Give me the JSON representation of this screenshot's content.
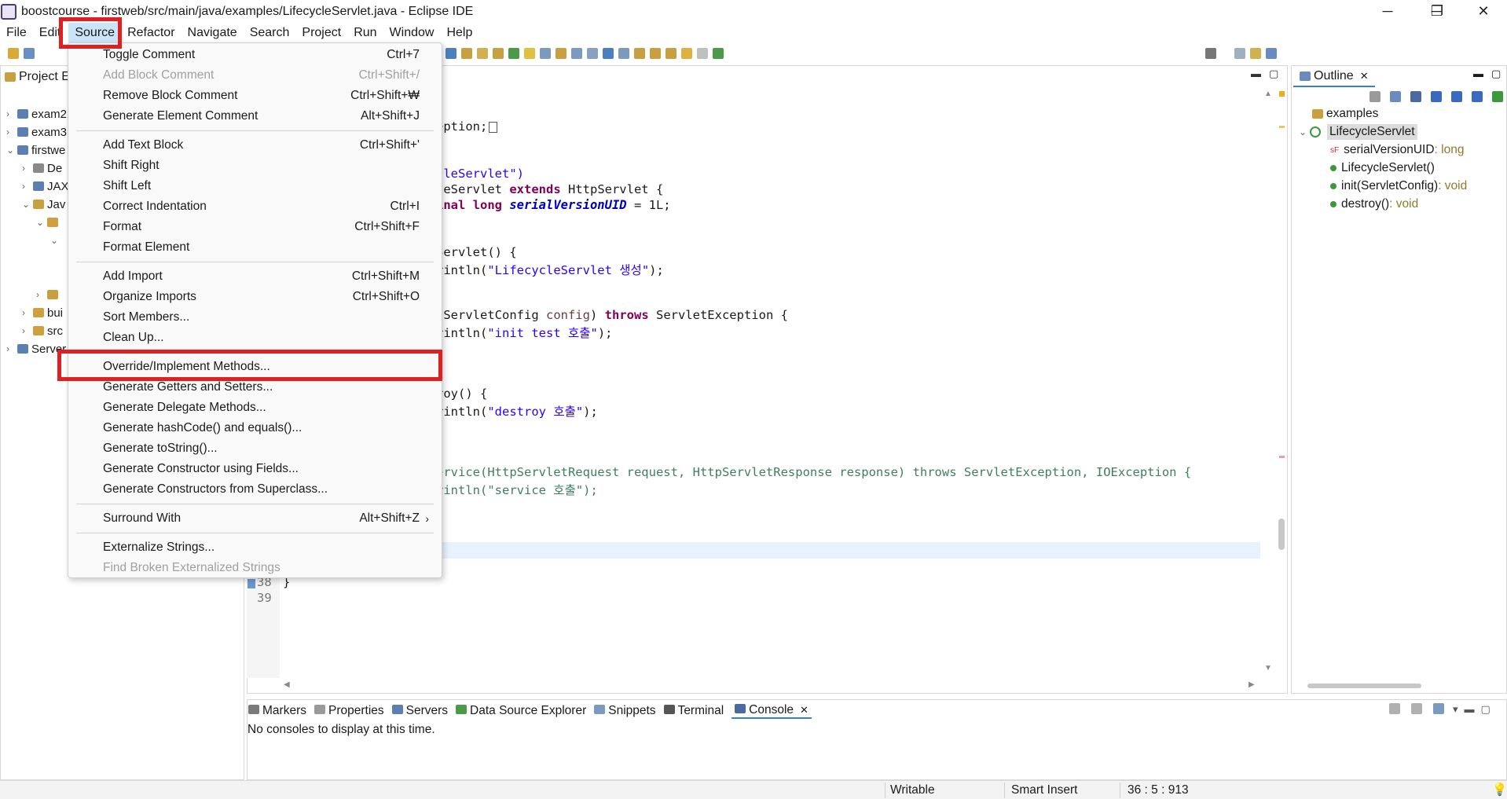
{
  "window": {
    "title": "boostcourse - firstweb/src/main/java/examples/LifecycleServlet.java - Eclipse IDE",
    "minimize_glyph": "─",
    "restore_glyph": "❐",
    "close_glyph": "✕"
  },
  "menubar": {
    "items": [
      "File",
      "Edit",
      "Source",
      "Refactor",
      "Navigate",
      "Search",
      "Project",
      "Run",
      "Window",
      "Help"
    ],
    "active": "Source"
  },
  "project_explorer": {
    "tab_label": "Project E",
    "rows": [
      {
        "label": "exam2",
        "chevron": "›"
      },
      {
        "label": "exam3",
        "chevron": "›"
      },
      {
        "label": "firstwe",
        "chevron": "⌄"
      },
      {
        "label": "De",
        "chevron": "›"
      },
      {
        "label": "JAX",
        "chevron": "›"
      },
      {
        "label": "Jav",
        "chevron": "⌄"
      },
      {
        "label": "",
        "chevron": "⌄"
      },
      {
        "label": "",
        "chevron": "⌄"
      },
      {
        "label": "",
        "chevron": "›"
      },
      {
        "label": "bui",
        "chevron": "›"
      },
      {
        "label": "src",
        "chevron": "›"
      },
      {
        "label": "Server",
        "chevron": "›"
      }
    ]
  },
  "editor": {
    "line_numbers": [
      "38",
      "39"
    ],
    "code_fragments": {
      "l1": "eption;",
      "l2a": "cleServlet\")",
      "l3a": "leServlet ",
      "l3b": "extends",
      "l3c": " HttpServlet {",
      "l4a": "inal long ",
      "l4b": "serialVersionUID",
      "l4c": " = 1L;",
      "l5": "Servlet() {",
      "l6a": "rintln(",
      "l6b": "\"LifecycleServlet 생성\"",
      "l6c": ");",
      "l7a": "(ServletConfig ",
      "l7b": "config",
      "l7c": ") ",
      "l7d": "throws",
      "l7e": " ServletException {",
      "l8a": "rintln(",
      "l8b": "\"init test 호출\"",
      "l8c": ");",
      "l9": "roy() {",
      "l10a": "rintln(",
      "l10b": "\"destroy 호출\"",
      "l10c": ");",
      "l11": "ervice(HttpServletRequest request, HttpServletResponse response) throws ServletException, IOException {",
      "l12": "rintln(\"service 호출\");",
      "l13": "}"
    }
  },
  "source_menu": {
    "groups": [
      [
        {
          "label": "Toggle Comment",
          "shortcut": "Ctrl+7",
          "enabled": true
        },
        {
          "label": "Add Block Comment",
          "shortcut": "Ctrl+Shift+/",
          "enabled": false
        },
        {
          "label": "Remove Block Comment",
          "shortcut": "Ctrl+Shift+₩",
          "enabled": true
        },
        {
          "label": "Generate Element Comment",
          "shortcut": "Alt+Shift+J",
          "enabled": true
        }
      ],
      [
        {
          "label": "Add Text Block",
          "shortcut": "Ctrl+Shift+'",
          "enabled": true
        },
        {
          "label": "Shift Right",
          "shortcut": "",
          "enabled": true
        },
        {
          "label": "Shift Left",
          "shortcut": "",
          "enabled": true
        },
        {
          "label": "Correct Indentation",
          "shortcut": "Ctrl+I",
          "enabled": true
        },
        {
          "label": "Format",
          "shortcut": "Ctrl+Shift+F",
          "enabled": true
        },
        {
          "label": "Format Element",
          "shortcut": "",
          "enabled": true
        }
      ],
      [
        {
          "label": "Add Import",
          "shortcut": "Ctrl+Shift+M",
          "enabled": true
        },
        {
          "label": "Organize Imports",
          "shortcut": "Ctrl+Shift+O",
          "enabled": true
        },
        {
          "label": "Sort Members...",
          "shortcut": "",
          "enabled": true
        },
        {
          "label": "Clean Up...",
          "shortcut": "",
          "enabled": true
        }
      ],
      [
        {
          "label": "Override/Implement Methods...",
          "shortcut": "",
          "enabled": true
        },
        {
          "label": "Generate Getters and Setters...",
          "shortcut": "",
          "enabled": true
        },
        {
          "label": "Generate Delegate Methods...",
          "shortcut": "",
          "enabled": true
        },
        {
          "label": "Generate hashCode() and equals()...",
          "shortcut": "",
          "enabled": true
        },
        {
          "label": "Generate toString()...",
          "shortcut": "",
          "enabled": true
        },
        {
          "label": "Generate Constructor using Fields...",
          "shortcut": "",
          "enabled": true
        },
        {
          "label": "Generate Constructors from Superclass...",
          "shortcut": "",
          "enabled": true
        }
      ],
      [
        {
          "label": "Surround With",
          "shortcut": "Alt+Shift+Z",
          "enabled": true,
          "submenu": true
        }
      ],
      [
        {
          "label": "Externalize Strings...",
          "shortcut": "",
          "enabled": true
        },
        {
          "label": "Find Broken Externalized Strings",
          "shortcut": "",
          "enabled": false
        }
      ]
    ],
    "submenu_arrow": "›"
  },
  "outline": {
    "tab_label": "Outline",
    "close_glyph": "✕",
    "items": [
      {
        "name": "examples",
        "suffix": "",
        "indent": 0,
        "icon": "package-icon"
      },
      {
        "name": "LifecycleServlet",
        "suffix": "",
        "indent": 0,
        "icon": "class-icon",
        "selected": true
      },
      {
        "name": "serialVersionUID",
        "suffix": " : long",
        "indent": 1,
        "icon": "static-final-field-icon"
      },
      {
        "name": "LifecycleServlet()",
        "suffix": "",
        "indent": 1,
        "icon": "constructor-icon"
      },
      {
        "name": "init(ServletConfig)",
        "suffix": " : void",
        "indent": 1,
        "icon": "public-method-icon"
      },
      {
        "name": "destroy()",
        "suffix": " : void",
        "indent": 1,
        "icon": "public-method-icon"
      }
    ]
  },
  "bottom_panel": {
    "tabs": [
      "Markers",
      "Properties",
      "Servers",
      "Data Source Explorer",
      "Snippets",
      "Terminal",
      "Console"
    ],
    "active_tab": "Console",
    "message": "No consoles to display at this time."
  },
  "statusbar": {
    "writable": "Writable",
    "insert_mode": "Smart Insert",
    "position": "36 : 5 : 913"
  },
  "colors": {
    "highlight_red": "#e02020",
    "menu_hover": "#cce4f7",
    "keyword": "#7f0055",
    "string": "#2a00ff"
  }
}
